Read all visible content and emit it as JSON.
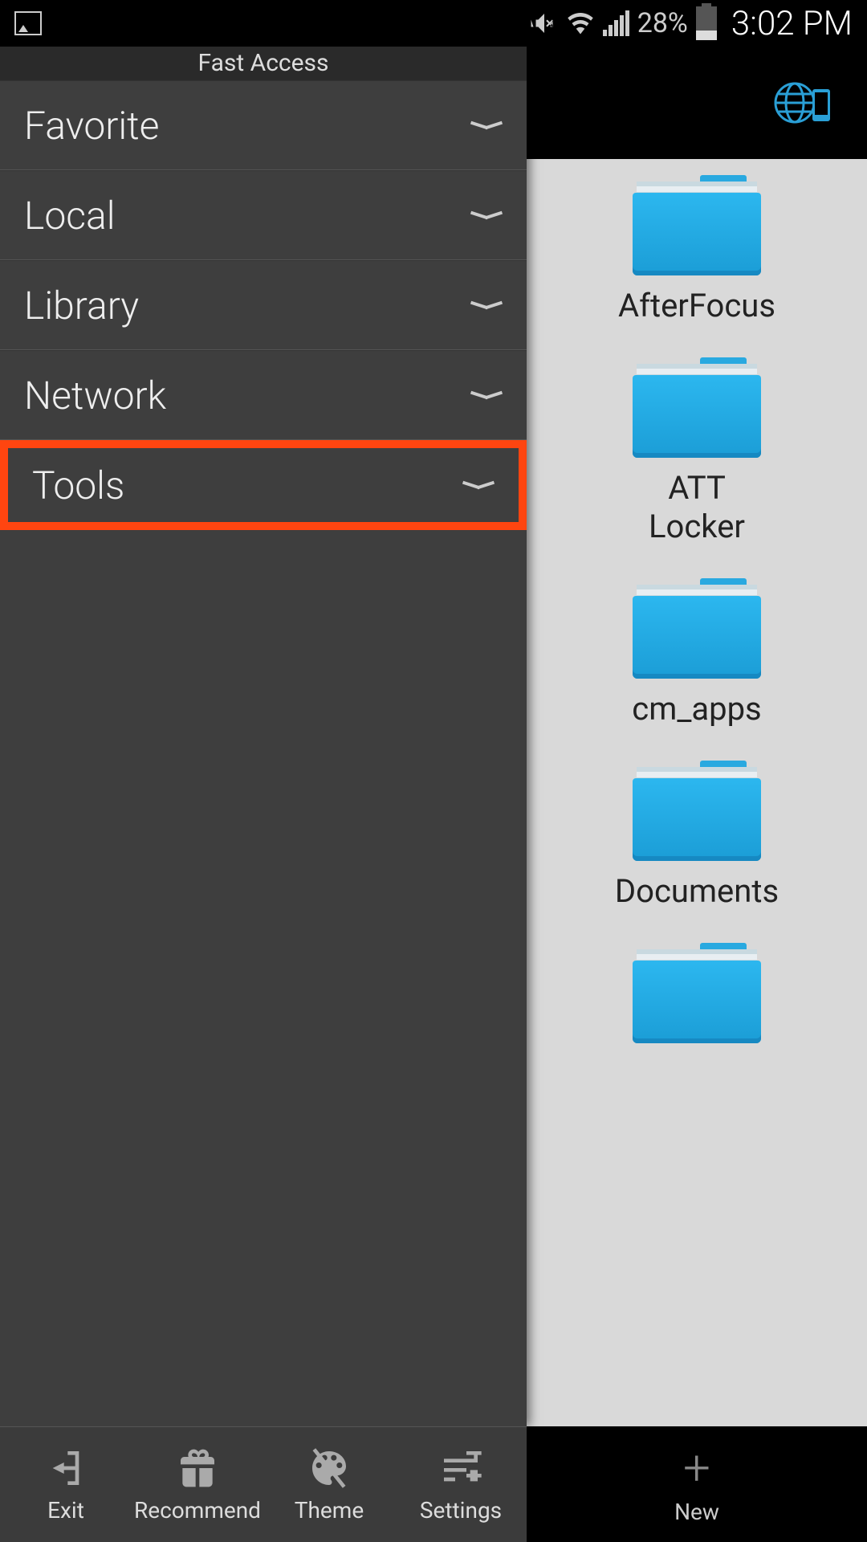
{
  "status_bar": {
    "battery_percent": "28%",
    "time": "3:02 PM"
  },
  "drawer": {
    "title": "Fast Access",
    "items": [
      {
        "label": "Favorite",
        "highlighted": false
      },
      {
        "label": "Local",
        "highlighted": false
      },
      {
        "label": "Library",
        "highlighted": false
      },
      {
        "label": "Network",
        "highlighted": false
      },
      {
        "label": "Tools",
        "highlighted": true
      }
    ]
  },
  "folders": [
    {
      "label": "AfterFocus"
    },
    {
      "label": "ATT Locker"
    },
    {
      "label": "cm_apps"
    },
    {
      "label": "Documents"
    }
  ],
  "bottom_bar": {
    "exit": "Exit",
    "recommend": "Recommend",
    "theme": "Theme",
    "settings": "Settings",
    "new": "New"
  },
  "colors": {
    "highlight": "#ff4510",
    "folder": "#1b9dd6"
  }
}
